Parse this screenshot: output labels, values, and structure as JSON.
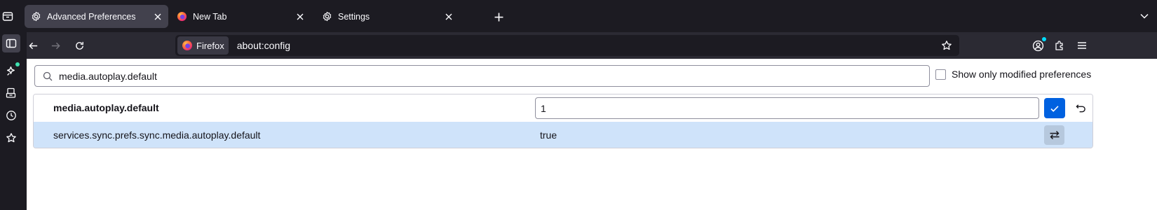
{
  "tabs": [
    {
      "label": "Advanced Preferences",
      "icon": "gear-icon",
      "active": true
    },
    {
      "label": "New Tab",
      "icon": "firefox-icon",
      "active": false
    },
    {
      "label": "Settings",
      "icon": "gear-icon",
      "active": false
    }
  ],
  "urlbar": {
    "identity_label": "Firefox",
    "url": "about:config"
  },
  "search": {
    "value": "media.autoplay.default"
  },
  "modified_toggle": {
    "label": "Show only modified preferences",
    "checked": false
  },
  "preferences": [
    {
      "name": "media.autoplay.default",
      "value": "1",
      "editing": true,
      "modified": true
    },
    {
      "name": "services.sync.prefs.sync.media.autoplay.default",
      "value": "true",
      "editing": false,
      "modified": false
    }
  ],
  "colors": {
    "accent": "#0061e0",
    "selected_row": "#cfe3fa",
    "chrome_dark": "#1c1b22",
    "toolbar": "#2b2a33"
  }
}
